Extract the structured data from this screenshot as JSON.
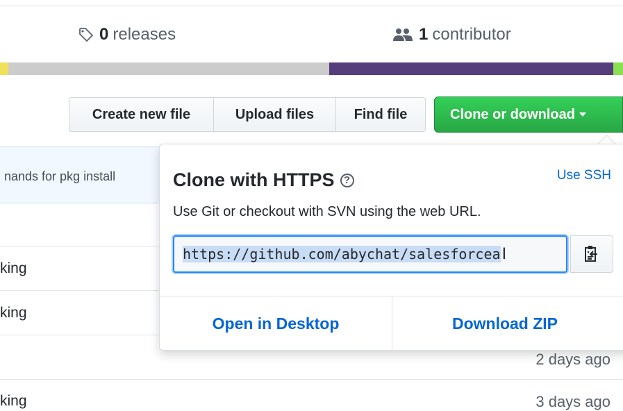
{
  "summary": {
    "releases_count": "0",
    "releases_label": "releases",
    "contributors_count": "1",
    "contributors_label": "contributor"
  },
  "language_bar": {
    "colors": [
      "#f1e05a",
      "#cccccc",
      "#563d7c",
      "#89e051"
    ]
  },
  "file_nav": {
    "create_new_file": "Create new file",
    "upload_files": "Upload files",
    "find_file": "Find file",
    "clone_or_download": "Clone or download"
  },
  "file_list": {
    "commit_message": "nands for pkg install",
    "rows": [
      {
        "text": "king",
        "age": ""
      },
      {
        "text": "king",
        "age": ""
      },
      {
        "text": "",
        "age": "2 days ago"
      },
      {
        "text": "king",
        "age": "3 days ago"
      }
    ]
  },
  "clone_panel": {
    "title": "Clone with HTTPS",
    "help_icon": "question-circle-icon",
    "use_ssh": "Use SSH",
    "description": "Use Git or checkout with SVN using the web URL.",
    "url_value": "https://github.com/abychat/salesforcea",
    "copy_icon": "clipboard-icon",
    "open_in_desktop": "Open in Desktop",
    "download_zip": "Download ZIP"
  },
  "colors": {
    "link": "#0366d6",
    "green_button": "#28a745",
    "input_focus": "#2188ff"
  }
}
